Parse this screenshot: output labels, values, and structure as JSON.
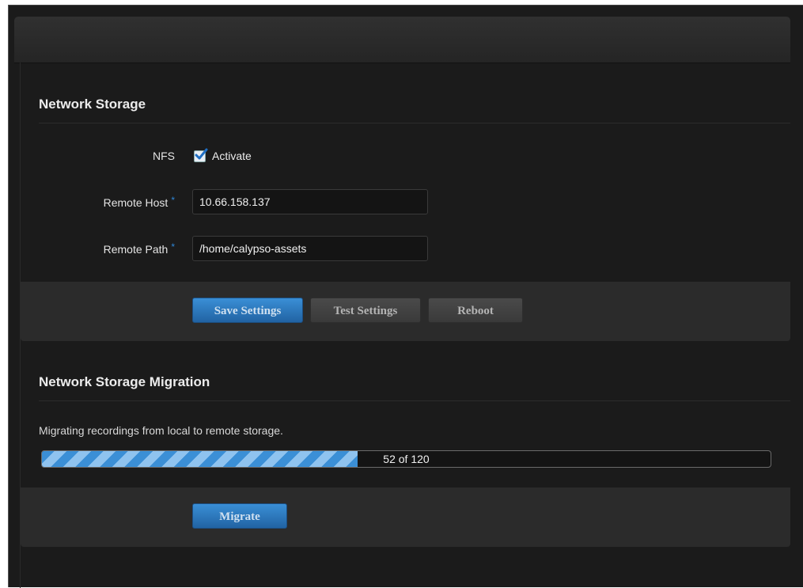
{
  "network_storage": {
    "title": "Network Storage",
    "nfs_label": "NFS",
    "activate_label": "Activate",
    "activate_checked": true,
    "remote_host_label": "Remote Host",
    "remote_host_value": "10.66.158.137",
    "remote_path_label": "Remote Path",
    "remote_path_value": "/home/calypso-assets",
    "required_marker": "*",
    "buttons": {
      "save": "Save Settings",
      "test": "Test Settings",
      "reboot": "Reboot"
    }
  },
  "migration": {
    "title": "Network Storage Migration",
    "description": "Migrating recordings from local to remote storage.",
    "progress_current": 52,
    "progress_total": 120,
    "progress_text": "52 of 120",
    "migrate_label": "Migrate"
  },
  "colors": {
    "accent": "#2f86d6",
    "background": "#1b1b1b",
    "panel": "#2b2b2b"
  }
}
